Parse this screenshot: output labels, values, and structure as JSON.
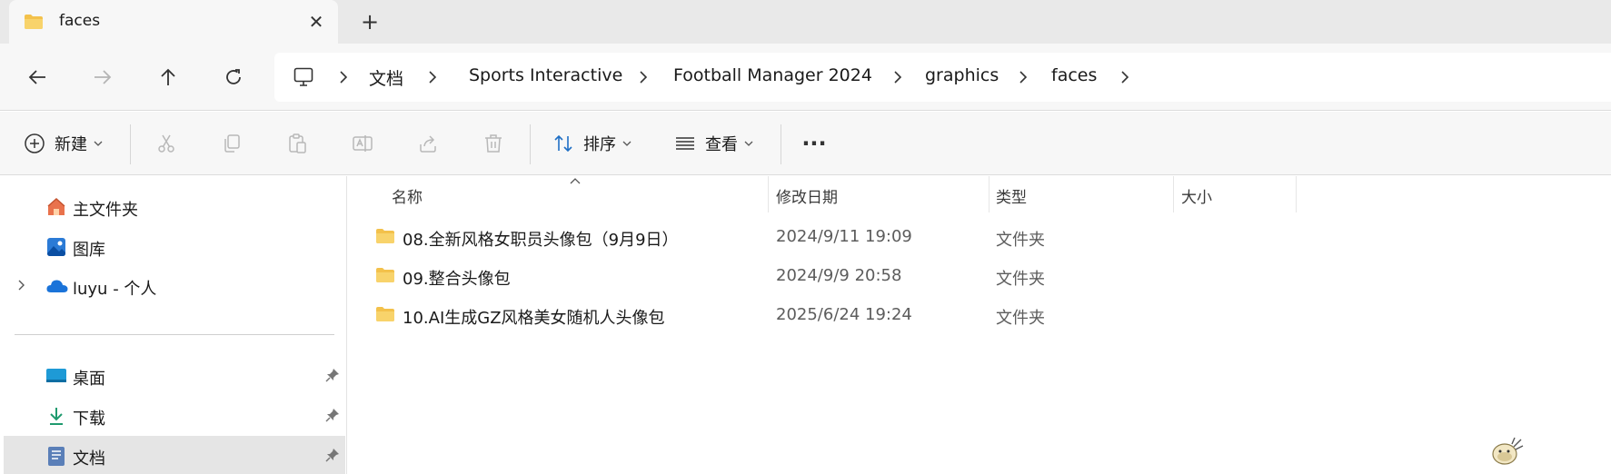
{
  "tab": {
    "title": "faces",
    "close_symbol": "✕",
    "new_tab_symbol": "+"
  },
  "breadcrumb": [
    "文档",
    "Sports Interactive",
    "Football Manager 2024",
    "graphics",
    "faces"
  ],
  "commands": {
    "new_label": "新建",
    "sort_label": "排序",
    "view_label": "查看",
    "more_symbol": "···"
  },
  "sidebar": {
    "items": [
      {
        "label": "主文件夹",
        "icon": "home-icon"
      },
      {
        "label": "图库",
        "icon": "gallery-icon"
      },
      {
        "label": "luyu - 个人",
        "icon": "onedrive-icon"
      },
      {
        "label": "桌面",
        "icon": "desktop-icon"
      },
      {
        "label": "下载",
        "icon": "download-icon"
      },
      {
        "label": "文档",
        "icon": "documents-icon"
      }
    ]
  },
  "columns": {
    "name": "名称",
    "date": "修改日期",
    "type": "类型",
    "size": "大小"
  },
  "files": [
    {
      "name": "08.全新风格女职员头像包（9月9日）",
      "date": "2024/9/11 19:09",
      "type": "文件夹"
    },
    {
      "name": "09.整合头像包",
      "date": "2024/9/9 20:58",
      "type": "文件夹"
    },
    {
      "name": "10.AI生成GZ风格美女随机人头像包",
      "date": "2025/6/24 19:24",
      "type": "文件夹"
    }
  ],
  "colors": {
    "folder": "#f3c14b",
    "accent": "#1f6fc5",
    "selected": "#e5e5e5"
  }
}
